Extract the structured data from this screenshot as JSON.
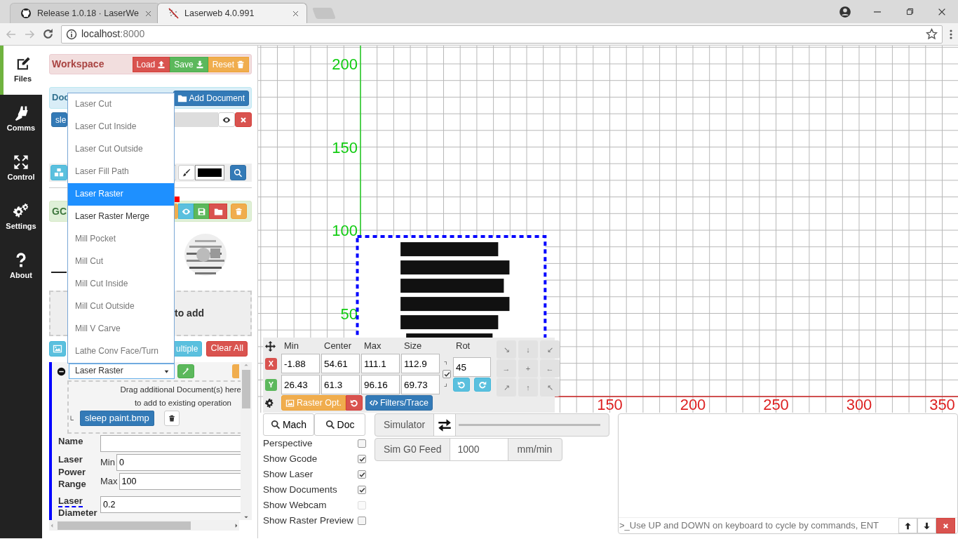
{
  "browser": {
    "tabs": [
      {
        "title": "Release 1.0.18 · LaserWe",
        "selected": false
      },
      {
        "title": "Laserweb 4.0.991",
        "selected": true
      }
    ],
    "address": {
      "host": "localhost",
      "port": ":8000"
    }
  },
  "nav": [
    {
      "label": "Files",
      "selected": true
    },
    {
      "label": "Comms",
      "selected": false
    },
    {
      "label": "Control",
      "selected": false
    },
    {
      "label": "Settings",
      "selected": false
    },
    {
      "label": "About",
      "selected": false
    }
  ],
  "workspace": {
    "title": "Workspace",
    "buttons": [
      "Load",
      "Save",
      "Reset"
    ]
  },
  "documents": {
    "title": "Doc",
    "add_button": "Add Document",
    "items": [
      "sle"
    ]
  },
  "gcode": {
    "title": "GC"
  },
  "drop_zone": {
    "text": "to add"
  },
  "operation_buttons": [
    "ultiple",
    "Clear All"
  ],
  "operation_menu": [
    {
      "label": "Laser Cut",
      "selected": false,
      "disabled": true
    },
    {
      "label": "Laser Cut Inside",
      "selected": false,
      "disabled": true
    },
    {
      "label": "Laser Cut Outside",
      "selected": false,
      "disabled": true
    },
    {
      "label": "Laser Fill Path",
      "selected": false,
      "disabled": true
    },
    {
      "label": "Laser Raster",
      "selected": true,
      "disabled": false
    },
    {
      "label": "Laser Raster Merge",
      "selected": false,
      "disabled": false
    },
    {
      "label": "Mill Pocket",
      "selected": false,
      "disabled": true
    },
    {
      "label": "Mill Cut",
      "selected": false,
      "disabled": true
    },
    {
      "label": "Mill Cut Inside",
      "selected": false,
      "disabled": true
    },
    {
      "label": "Mill Cut Outside",
      "selected": false,
      "disabled": true
    },
    {
      "label": "Mill V Carve",
      "selected": false,
      "disabled": true
    },
    {
      "label": "Lathe Conv Face/Turn",
      "selected": false,
      "disabled": true
    }
  ],
  "operation": {
    "type": "Laser Raster",
    "drop_hint": [
      "Drag additional Document(s) here",
      "to add to existing operation"
    ],
    "documents": [
      "sleep paint.bmp"
    ],
    "name": {
      "label": "Name"
    },
    "power": {
      "label": "Laser Power Range",
      "min_label": "Min",
      "min": "0",
      "max_label": "Max",
      "max": "100"
    },
    "diameter": {
      "label_top": "Laser",
      "label_bottom": "Diameter",
      "value": "0.2"
    }
  },
  "canvas": {
    "y_labels": [
      "200",
      "150",
      "100",
      "50"
    ],
    "x_labels": [
      "150",
      "200",
      "250",
      "300",
      "350"
    ]
  },
  "transform": {
    "headers": [
      "Min",
      "Center",
      "Max",
      "Size",
      "Rot"
    ],
    "rows": [
      {
        "axis": "X",
        "values": [
          "-1.88",
          "54.61",
          "111.1",
          "112.9"
        ]
      },
      {
        "axis": "Y",
        "values": [
          "26.43",
          "61.3",
          "96.16",
          "69.73"
        ]
      }
    ],
    "lock_aspect": true,
    "rotation": "45",
    "buttons": [
      "Raster Opt.",
      "Filters/Trace"
    ],
    "jog": [
      "↘",
      "↓",
      "↙",
      "→",
      "+",
      "←",
      "↗",
      "↑",
      "↖"
    ]
  },
  "view": {
    "buttons": [
      "Mach",
      "Doc"
    ],
    "options": [
      {
        "label": "Perspective",
        "checked": false,
        "disabled": false
      },
      {
        "label": "Show Gcode",
        "checked": true,
        "disabled": false
      },
      {
        "label": "Show Laser",
        "checked": true,
        "disabled": false
      },
      {
        "label": "Show Documents",
        "checked": true,
        "disabled": false
      },
      {
        "label": "Show Webcam",
        "checked": false,
        "disabled": true
      },
      {
        "label": "Show Raster Preview",
        "checked": false,
        "disabled": false
      }
    ]
  },
  "simulator": {
    "label": "Simulator"
  },
  "sim_feed": {
    "label": "Sim G0 Feed",
    "value": "1000",
    "unit": "mm/min"
  },
  "console": {
    "placeholder": ">_Use UP and DOWN on keyboard to cycle by commands, ENT"
  }
}
